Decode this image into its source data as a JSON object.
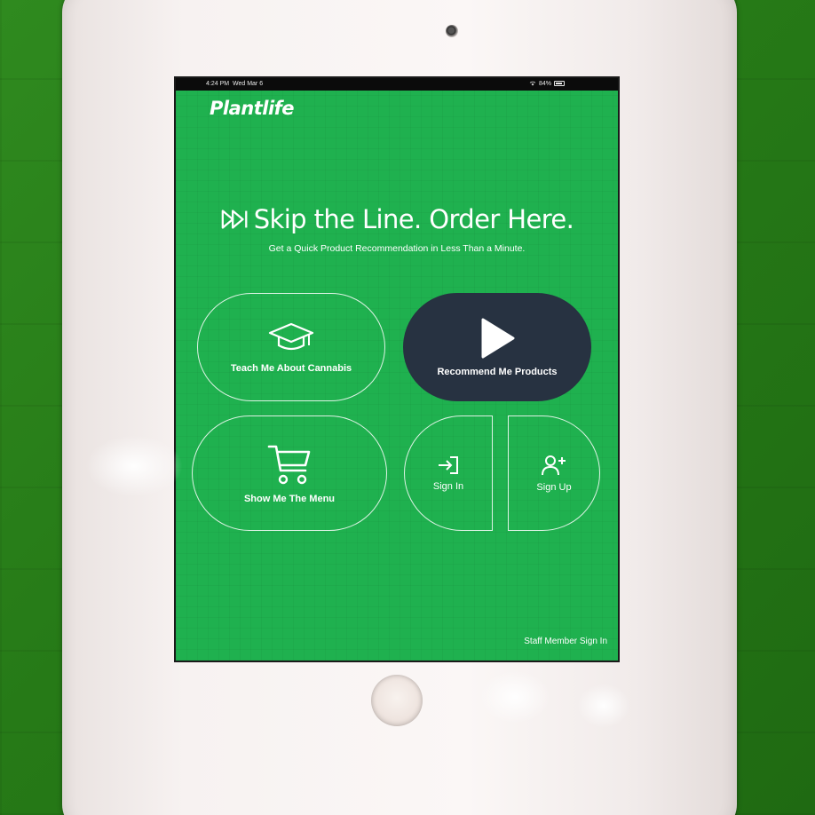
{
  "status_bar": {
    "time": "4:24 PM",
    "date": "Wed Mar 6",
    "battery": "84%",
    "icons": [
      "wifi-icon",
      "battery-icon"
    ]
  },
  "brand": {
    "logo": "Plantlife"
  },
  "hero": {
    "headline": "Skip the Line. Order Here.",
    "subtitle": "Get a Quick Product Recommendation in Less Than a Minute.",
    "icon": "fast-forward-icon"
  },
  "actions": {
    "teach": {
      "label": "Teach Me About Cannabis",
      "icon": "graduation-cap-icon"
    },
    "recommend": {
      "label": "Recommend Me Products",
      "icon": "play-icon"
    },
    "menu": {
      "label": "Show Me The Menu",
      "icon": "shopping-cart-icon"
    },
    "sign_in": {
      "label": "Sign In",
      "icon": "sign-in-icon"
    },
    "sign_up": {
      "label": "Sign Up",
      "icon": "add-user-icon"
    }
  },
  "footer": {
    "staff_sign_in": "Staff Member Sign In"
  },
  "colors": {
    "screen_green": "#1fb14f",
    "recommend_button": "#273241",
    "text": "#ffffff"
  }
}
